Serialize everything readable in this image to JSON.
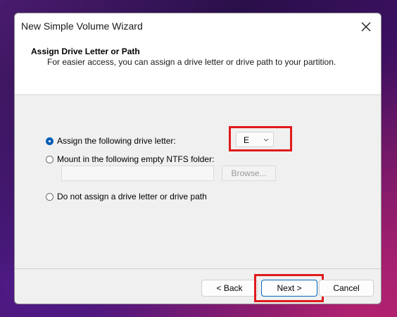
{
  "window": {
    "title": "New Simple Volume Wizard"
  },
  "header": {
    "title": "Assign Drive Letter or Path",
    "subtitle": "For easier access, you can assign a drive letter or drive path to your partition."
  },
  "options": {
    "assign_letter": {
      "label": "Assign the following drive letter:",
      "selected": true
    },
    "mount_folder": {
      "label": "Mount in the following empty NTFS folder:",
      "selected": false
    },
    "no_assign": {
      "label": "Do not assign a drive letter or drive path",
      "selected": false
    }
  },
  "drive_letter": {
    "value": "E"
  },
  "folder_path": {
    "value": ""
  },
  "browse": {
    "label": "Browse..."
  },
  "buttons": {
    "back": "< Back",
    "next": "Next >",
    "cancel": "Cancel"
  },
  "colors": {
    "accent": "#005fb8",
    "highlight": "#e01b1b"
  }
}
